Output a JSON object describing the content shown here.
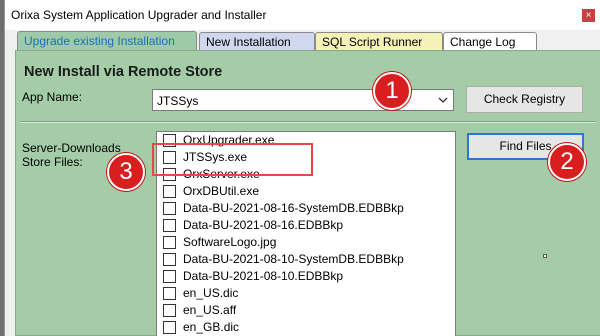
{
  "window": {
    "title": "Orixa System Application Upgrader and Installer",
    "close_glyph": "×"
  },
  "tabs": [
    {
      "label": "Upgrade existing Installation",
      "active": true
    },
    {
      "label": "New Installation"
    },
    {
      "label": "SQL Script Runner"
    },
    {
      "label": "Change Log"
    }
  ],
  "panel": {
    "heading": "New Install via Remote Store",
    "app_name_label": "App Name:",
    "app_name_value": "JTSSys",
    "check_registry_label": "Check Registry",
    "find_files_label": "Find Files",
    "files_label_line1": "Server-Downloads",
    "files_label_line2": "Store Files:"
  },
  "files": [
    "OrxUpgrader.exe",
    "JTSSys.exe",
    "OrxServer.exe",
    "OrxDBUtil.exe",
    "Data-BU-2021-08-16-SystemDB.EDBBkp",
    "Data-BU-2021-08-16.EDBBkp",
    "SoftwareLogo.jpg",
    "Data-BU-2021-08-10-SystemDB.EDBBkp",
    "Data-BU-2021-08-10.EDBBkp",
    "en_US.dic",
    "en_US.aff",
    "en_GB.dic"
  ],
  "callouts": [
    "1",
    "2",
    "3"
  ],
  "colors": {
    "panel_bg": "#a4cca7",
    "callout": "#d81e1e",
    "highlight": "#e44a4a",
    "active_tab_text": "#1a6fb8"
  }
}
